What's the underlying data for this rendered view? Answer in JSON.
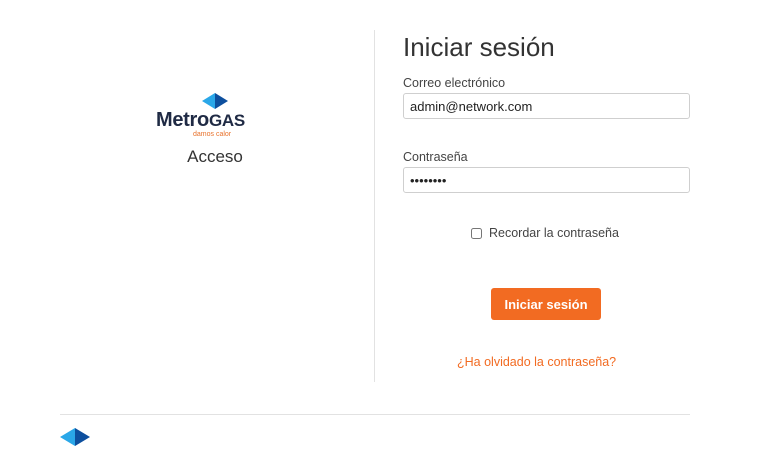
{
  "brand": {
    "name_prefix": "Metro",
    "name_suffix": "GAS",
    "tagline": "damos calor",
    "colors": {
      "navy": "#1f2a44",
      "blue": "#1e88d8",
      "orange": "#f26b22"
    }
  },
  "left": {
    "access_label": "Acceso"
  },
  "login": {
    "title": "Iniciar sesión",
    "email_label": "Correo electrónico",
    "email_value": "admin@network.com",
    "password_label": "Contraseña",
    "password_value": "password",
    "remember_label": "Recordar la contraseña",
    "remember_checked": false,
    "submit_label": "Iniciar sesión",
    "forgot_label": "¿Ha olvidado la contraseña?"
  },
  "icons": {
    "logo_mark": "diamond-logo-icon",
    "footer_mark": "diamond-logo-icon"
  }
}
